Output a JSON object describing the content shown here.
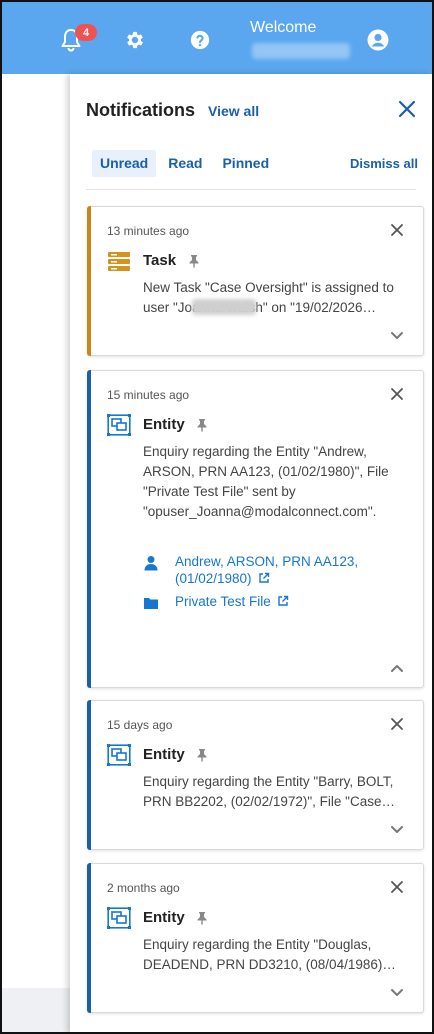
{
  "header": {
    "notification_count": "4",
    "welcome": "Welcome",
    "icons": [
      "bell-icon",
      "gear-icon",
      "help-icon",
      "user-circle-icon"
    ],
    "color": "#5aa7f0"
  },
  "panel": {
    "title": "Notifications",
    "view_all": "View all",
    "tabs": [
      {
        "label": "Unread",
        "active": true
      },
      {
        "label": "Read",
        "active": false
      },
      {
        "label": "Pinned",
        "active": false
      }
    ],
    "dismiss_all": "Dismiss all"
  },
  "notifications": [
    {
      "time": "13 minutes ago",
      "type": "Task",
      "icon": "task-list-icon",
      "stripe_color": "#c8861a",
      "body": "New Task \"Case Oversight\" is assigned to user \"Joanna Walsh\" on \"19/02/2026…",
      "expanded": false
    },
    {
      "time": "15 minutes ago",
      "type": "Entity",
      "icon": "entity-icon",
      "stripe_color": "#1a5fa8",
      "body": "Enquiry regarding the Entity \"Andrew, ARSON, PRN AA123, (01/02/1980)\", File \"Private Test File\" sent by \"opuser_Joanna@modalconnect.com\".",
      "expanded": true,
      "links": [
        {
          "label": "Andrew, ARSON, PRN AA123, (01/02/1980)",
          "icon": "person-icon"
        },
        {
          "label": "Private Test File",
          "icon": "folder-icon"
        }
      ]
    },
    {
      "time": "15 days ago",
      "type": "Entity",
      "icon": "entity-icon",
      "stripe_color": "#1a5fa8",
      "body": "Enquiry regarding the Entity \"Barry, BOLT, PRN BB2202, (02/02/1972)\", File \"Case…",
      "expanded": false
    },
    {
      "time": "2 months ago",
      "type": "Entity",
      "icon": "entity-icon",
      "stripe_color": "#1a5fa8",
      "body": "Enquiry regarding the Entity \"Douglas, DEADEND, PRN DD3210, (08/04/1986)…",
      "expanded": false
    }
  ]
}
